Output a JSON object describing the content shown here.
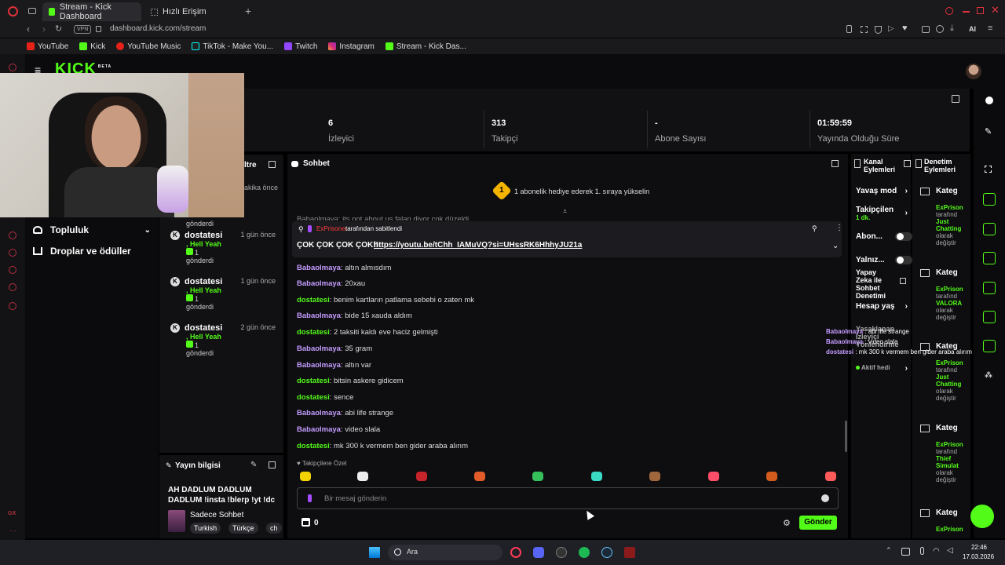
{
  "browser": {
    "tabs": [
      {
        "label": "Stream - Kick Dashboard"
      },
      {
        "label": "Hızlı Erişim"
      }
    ],
    "vpn": "VPN",
    "url": "dashboard.kick.com/stream",
    "ai": "AI",
    "bookmarks": [
      {
        "label": "YouTube"
      },
      {
        "label": "Kick"
      },
      {
        "label": "YouTube Music"
      },
      {
        "label": "TikTok - Make You..."
      },
      {
        "label": "Twitch"
      },
      {
        "label": "Instagram"
      },
      {
        "label": "Stream - Kick Das..."
      }
    ]
  },
  "kick": {
    "logo": "KICK",
    "beta": "BETA"
  },
  "stats": [
    {
      "value": "6",
      "label": "İzleyici"
    },
    {
      "value": "313",
      "label": "Takipçi"
    },
    {
      "value": "-",
      "label": "Abone Sayısı"
    },
    {
      "value": "01:59:59",
      "label": "Yayında Olduğu Süre"
    }
  ],
  "sidenav": [
    {
      "label": "Topluluk"
    },
    {
      "label": "Droplar ve ödüller"
    }
  ],
  "activity": {
    "title_fragment": "ltre",
    "first_time": "akika önce",
    "first_gifted": "gönderdi",
    "items": [
      {
        "name": "dostatesi",
        "time": "1 gün önce",
        "msg": ", Hell Yeah",
        "count": "1",
        "action": "gönderdi"
      },
      {
        "name": "dostatesi",
        "time": "1 gün önce",
        "msg": ", Hell Yeah",
        "count": "1",
        "action": "gönderdi"
      },
      {
        "name": "dostatesi",
        "time": "2 gün önce",
        "msg": ", Hell Yeah",
        "count": "1",
        "action": "gönderdi"
      }
    ]
  },
  "stream_info": {
    "title": "Yayın bilgisi",
    "stream_title": "AH DADLUM DADLUM DADLUM !insta !blerp !yt !dc",
    "category": "Sadece Sohbet",
    "tags": [
      "Turkish",
      "Türkçe",
      "ch"
    ]
  },
  "chat": {
    "title": "Sohbet",
    "gift_badge": "1",
    "gift_text": "1 abonelik hediye ederek 1. sıraya yükselin",
    "partial_line": "Babaolmaya: its not about us falan diyor çok düzeldi",
    "pinned_by_user": "ExPrisoner",
    "pinned_by_text": "tarafından sabitlendi",
    "pinned_text": "ÇOK ÇOK ÇOK ÇOK!!",
    "pinned_link": "https://youtu.be/tChh_IAMuVQ?si=UHssRK6HhhyJU21a",
    "messages": [
      {
        "user": "Babaolmaya",
        "text": "altın almısdım"
      },
      {
        "user": "Babaolmaya",
        "text": "20xau"
      },
      {
        "user": "dostatesi",
        "text": "benim kartların patlama sebebi o zaten mk"
      },
      {
        "user": "Babaolmaya",
        "text": "bide 15 xauda aldım"
      },
      {
        "user": "dostatesi",
        "text": "2 taksiti kaldı eve haciz gelmişti"
      },
      {
        "user": "Babaolmaya",
        "text": "35 gram"
      },
      {
        "user": "Babaolmaya",
        "text": "altın var"
      },
      {
        "user": "dostatesi",
        "text": "bitsin askere gidicem"
      },
      {
        "user": "dostatesi",
        "text": "sence"
      },
      {
        "user": "Babaolmaya",
        "text": "abi life strange"
      },
      {
        "user": "Babaolmaya",
        "text": "video slala"
      },
      {
        "user": "dostatesi",
        "text": "mk 300 k vermem ben gider araba alırım"
      }
    ],
    "follower_only": "Takipçilere Özel",
    "input_placeholder": "Bir mesaj gönderin",
    "points": "0",
    "send": "Gönder"
  },
  "channel_actions": {
    "title": "Kanal Eylemleri",
    "items": [
      {
        "label": "Yavaş mod"
      },
      {
        "label": "Takipçilen",
        "sub": "1 dk."
      },
      {
        "label": "Abon..."
      },
      {
        "label": "Yalnız..."
      },
      {
        "label": "Yapay Zeka ile Sohbet Denetimi"
      },
      {
        "label": "Hesap yaş"
      },
      {
        "label": "Yasaklanan İzleyici Yönlendirme"
      },
      {
        "label": "Aktif hedi"
      }
    ]
  },
  "mod_actions": {
    "title": "Denetim Eylemleri",
    "items": [
      {
        "title": "Kateg",
        "user": "ExPrison",
        "t1": "tarafınd",
        "game": "Just Chatting",
        "t2": "olarak",
        "t3": "değiştir"
      },
      {
        "title": "Kateg",
        "user": "ExPrison",
        "t1": "tarafınd",
        "game": "VALORA",
        "t2": "olarak",
        "t3": "değiştir"
      },
      {
        "title": "Kateg",
        "user": "ExPrison",
        "t1": "tarafınd",
        "game": "Just Chatting",
        "t2": "olarak",
        "t3": "değiştir"
      },
      {
        "title": "Kateg",
        "user": "ExPrison",
        "t1": "tarafınd",
        "game": "Thief Simulat",
        "t2": "olarak",
        "t3": "değiştir"
      },
      {
        "title": "Kateg",
        "user": "ExPrison",
        "t1": "",
        "game": "",
        "t2": "",
        "t3": ""
      }
    ]
  },
  "overlay_chat": [
    {
      "user": "Babaolmaya",
      "text": "abi life strange"
    },
    {
      "user": "Babaolmaya",
      "text": "video slala"
    },
    {
      "user": "dostatesi",
      "text": "mk 300 k vermem ben gider araba alırım"
    }
  ],
  "taskbar": {
    "search": "Ara",
    "time": "22:46",
    "date": "17.03.2026"
  },
  "colors": {
    "accent": "#53fc18",
    "chat_user": "#c59cff",
    "danger": "#b3303b"
  }
}
